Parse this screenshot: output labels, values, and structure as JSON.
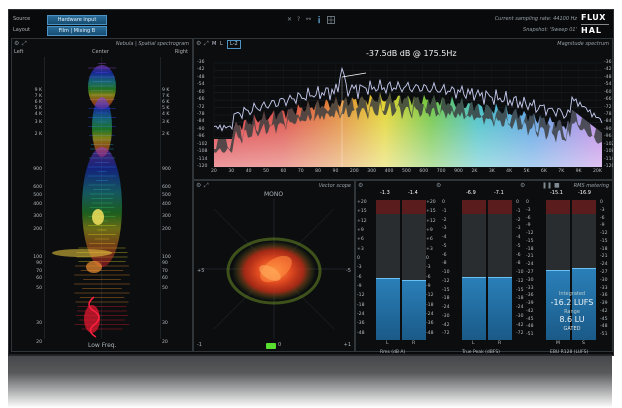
{
  "toolbar": {
    "source_label": "Source",
    "source_value": "Hardware input",
    "layout_label": "Layout",
    "layout_value": "Film | Mixing B",
    "sampling_rate": "Current sampling rate: 44100 Hz",
    "snapshot": "Snapshot: 'Sweep 01'",
    "logo_top": "FLUX",
    "logo_bottom": "HAL",
    "center_icons": [
      "close-icon",
      "help-icon",
      "link-icon",
      "info-icon",
      "grid-icon"
    ]
  },
  "spectrogram": {
    "title": "Nebula | Spatial spectrogram",
    "left": "Left",
    "center": "Center",
    "right": "Right",
    "bottom_label": "Low Freq.",
    "freq_ticks": [
      "9 K",
      "7 K",
      "6 K",
      "5 K",
      "4 K",
      "3 K",
      "2 K",
      "900",
      "600",
      "500",
      "400",
      "300",
      "200",
      "100",
      "90",
      "70",
      "60",
      "50",
      "30",
      "20"
    ]
  },
  "magnitude": {
    "title": "Magnitude spectrum",
    "tab_a": "M",
    "tab_b": "L",
    "tab_c": "L-2",
    "peak_readout": "-37.5dB dB @ 175.5Hz",
    "y_ticks": [
      "-36",
      "-42",
      "-48",
      "-54",
      "-60",
      "-66",
      "-72",
      "-78",
      "-84",
      "-90",
      "-96",
      "-102",
      "-108",
      "-114",
      "-120"
    ],
    "x_ticks": [
      "20",
      "30",
      "40",
      "50",
      "60",
      "70",
      "80",
      "90",
      "200",
      "300",
      "400",
      "500",
      "600",
      "700",
      "900",
      "2K",
      "3K",
      "4K",
      "5K",
      "6K",
      "7K",
      "9K",
      "20K"
    ],
    "colors": {
      "low": "#e8202a",
      "mid": "#f4e020",
      "high": "#40c8e8",
      "top": "#b070f0",
      "trace": "#c8ccf0"
    }
  },
  "vector_scope": {
    "title": "Vector scope",
    "mono": "MONO",
    "left_axis": "+5",
    "right_axis": "-5",
    "bottom_left": "-1",
    "bottom_center": "0",
    "bottom_right": "+1"
  },
  "meters": {
    "title": "RMS metering",
    "groups": [
      {
        "title": "Rms (dB A)",
        "peak_l": "-1.3",
        "peak_r": "-1.4",
        "ch_l": "L",
        "ch_r": "R",
        "level_l": 0.7,
        "level_r": 0.68
      },
      {
        "title": "True Peak (dBFS)",
        "peak_l": "-6.9",
        "peak_r": "-7.1",
        "ch_l": "L",
        "ch_r": "R",
        "level_l": 0.72,
        "level_r": 0.71
      },
      {
        "title": "EBU R128 (LUFS)",
        "peak_l": "-15.1",
        "peak_r": "-16.9",
        "ch_l": "M",
        "ch_r": "S",
        "level_l": 0.8,
        "level_r": 0.82
      }
    ],
    "scale_a": [
      "+20",
      "+15",
      "+12",
      "+9",
      "+6",
      "+3",
      "0",
      "-3",
      "-6",
      "-9",
      "-12",
      "-18",
      "-24",
      "-36",
      "-48"
    ],
    "scale_b": [
      "0",
      "-1",
      "-2",
      "-3",
      "-4",
      "-5",
      "-6",
      "-8",
      "-10",
      "-12",
      "-15",
      "-18",
      "-24",
      "-30",
      "-42",
      "-72"
    ],
    "scale_c": [
      "0",
      "-3",
      "-6",
      "-9",
      "-12",
      "-15",
      "-18",
      "-21",
      "-24",
      "-27",
      "-30",
      "-33",
      "-36",
      "-39",
      "-42",
      "-45",
      "-48",
      "-51"
    ],
    "integrated_label": "Integrated",
    "integrated_value": "-16.2 LUFS",
    "range_label": "Range",
    "range_value": "8.6 LU",
    "gated_label": "GATED"
  }
}
